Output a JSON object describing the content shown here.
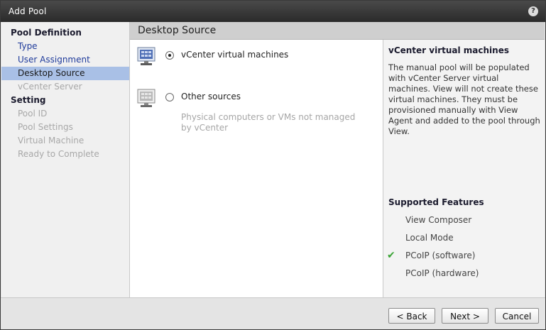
{
  "window": {
    "title": "Add Pool"
  },
  "nav": {
    "sections": [
      {
        "label": "Pool Definition"
      },
      {
        "label": "Setting"
      }
    ],
    "items": [
      {
        "label": "Type",
        "state": "link"
      },
      {
        "label": "User Assignment",
        "state": "link"
      },
      {
        "label": "Desktop Source",
        "state": "active"
      },
      {
        "label": "vCenter Server",
        "state": "disabled"
      },
      {
        "label": "Pool ID",
        "state": "disabled"
      },
      {
        "label": "Pool Settings",
        "state": "disabled"
      },
      {
        "label": "Virtual Machine",
        "state": "disabled"
      },
      {
        "label": "Ready to Complete",
        "state": "disabled"
      }
    ]
  },
  "main": {
    "header": "Desktop Source",
    "options": [
      {
        "label": "vCenter virtual machines",
        "selected": true,
        "description": ""
      },
      {
        "label": "Other sources",
        "selected": false,
        "description": "Physical computers or VMs not managed by vCenter"
      }
    ]
  },
  "info": {
    "heading": "vCenter virtual machines",
    "description": "The manual pool will be populated with vCenter Server virtual machines. View will not create these virtual machines. They must be provisioned manually with View Agent and added to the pool through View.",
    "features_heading": "Supported Features",
    "features": [
      {
        "label": "View Composer",
        "supported": false
      },
      {
        "label": "Local Mode",
        "supported": false
      },
      {
        "label": "PCoIP (software)",
        "supported": true
      },
      {
        "label": "PCoIP (hardware)",
        "supported": false
      }
    ]
  },
  "footer": {
    "back_label": "< Back",
    "next_label": "Next >",
    "cancel_label": "Cancel"
  },
  "icons": {
    "help": "help-icon",
    "vm": "vcenter-vm-icon",
    "other": "other-source-icon",
    "check": "check-icon"
  },
  "colors": {
    "accent": "#a9c0e6",
    "link": "#1f3b9b",
    "check": "#3aa335"
  }
}
